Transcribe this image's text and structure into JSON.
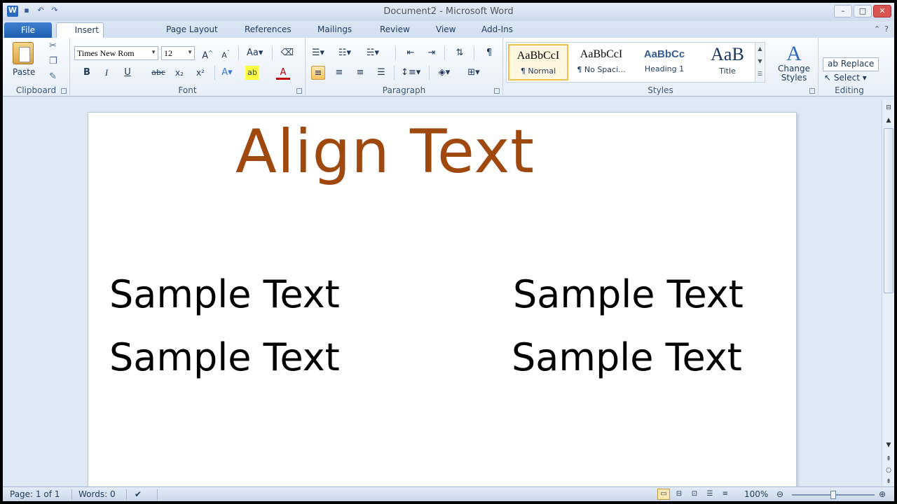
{
  "window": {
    "title": "Document2 - Microsoft Word"
  },
  "tabs": {
    "file": "File",
    "active": "Insert",
    "others": [
      {
        "label": "Page Layout"
      },
      {
        "label": "References"
      },
      {
        "label": "Mailings"
      },
      {
        "label": "Review"
      },
      {
        "label": "View"
      },
      {
        "label": "Add-Ins"
      }
    ]
  },
  "clipboard": {
    "group_label": "Clipboard",
    "paste_label": "Paste"
  },
  "font": {
    "group_label": "Font",
    "family": "Times New Rom",
    "size": "12",
    "change_case": "Aa",
    "bold": "B",
    "italic": "I",
    "underline": "U",
    "strike": "abc",
    "subscript": "x₂",
    "superscript": "x²"
  },
  "paragraph": {
    "group_label": "Paragraph",
    "pilcrow": "¶"
  },
  "styles": {
    "group_label": "Styles",
    "items": [
      {
        "sample": "AaBbCcI",
        "name": "¶ Normal"
      },
      {
        "sample": "AaBbCcI",
        "name": "¶ No Spaci..."
      },
      {
        "sample": "AaBbCc",
        "name": "Heading 1"
      },
      {
        "sample": "AaB",
        "name": "Title"
      }
    ],
    "change_styles": "Change Styles"
  },
  "editing": {
    "group_label": "Editing",
    "replace": "Replace",
    "select": "Select"
  },
  "document": {
    "title_text": "Align Text",
    "samples": [
      {
        "text": "Sample Text"
      },
      {
        "text": "Sample Text"
      },
      {
        "text": "Sample Text"
      },
      {
        "text": "Sample Text"
      }
    ]
  },
  "status": {
    "page": "Page: 1 of 1",
    "words": "Words: 0",
    "zoom": "100%"
  },
  "colors": {
    "title_text": "#a0490f",
    "file_tab": "#2a6bc0",
    "highlight": "#f5c35e"
  }
}
